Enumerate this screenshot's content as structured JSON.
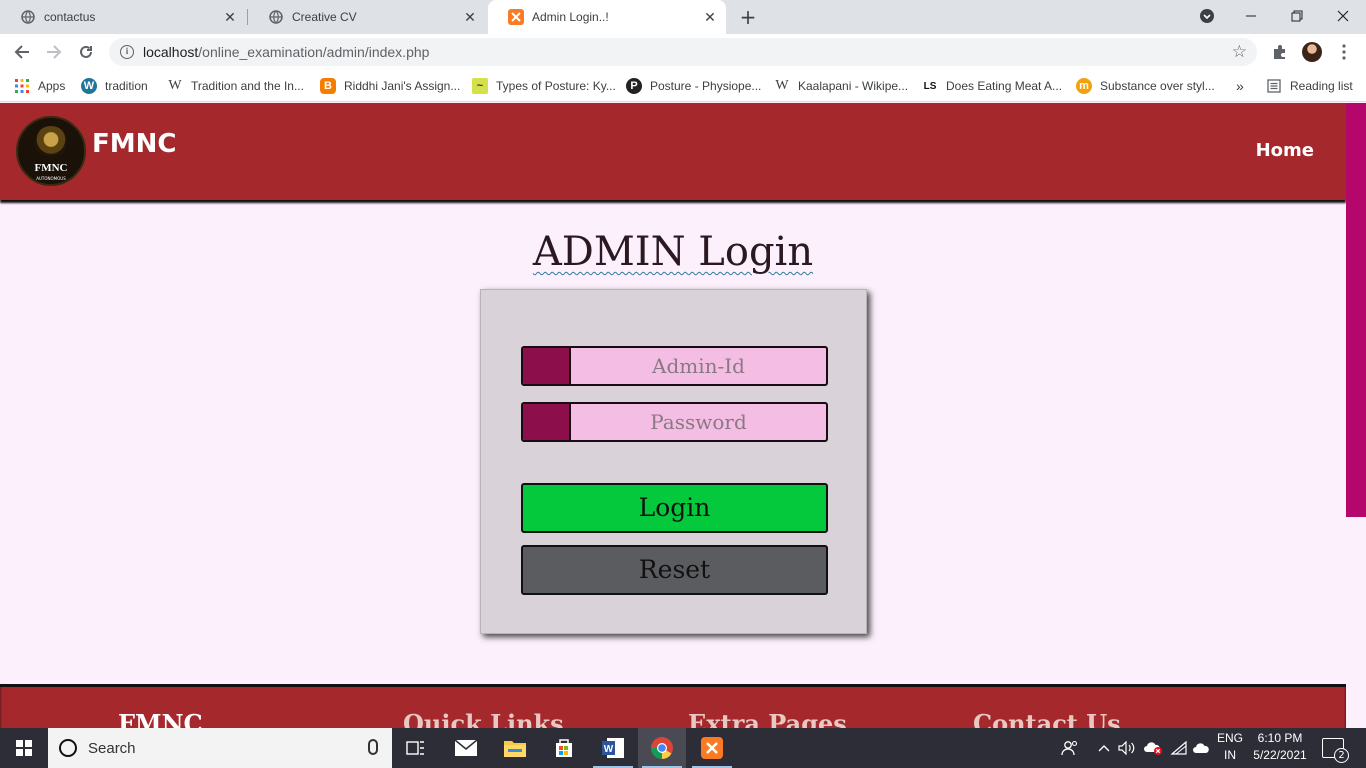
{
  "browser": {
    "tabs": [
      {
        "title": "contactus",
        "active": false
      },
      {
        "title": "Creative CV",
        "active": false
      },
      {
        "title": "Admin Login..!",
        "active": true
      }
    ],
    "url_host": "localhost",
    "url_path": "/online_examination/admin/index.php",
    "bookmarks": [
      {
        "label": "Apps",
        "icon": "apps-grid-icon"
      },
      {
        "label": "tradition",
        "icon": "wordpress-icon"
      },
      {
        "label": "Tradition and the In...",
        "icon": "wikipedia-icon"
      },
      {
        "label": "Riddhi Jani's Assign...",
        "icon": "blogger-icon"
      },
      {
        "label": "Types of Posture: Ky...",
        "icon": "site-icon"
      },
      {
        "label": "Posture - Physiope...",
        "icon": "physiopedia-icon"
      },
      {
        "label": "Kaalapani - Wikipe...",
        "icon": "wikipedia-icon"
      },
      {
        "label": "Does Eating Meat A...",
        "icon": "ls-icon"
      },
      {
        "label": "Substance over styl...",
        "icon": "site-icon"
      }
    ],
    "more_bookmarks": "»",
    "reading_list": "Reading list"
  },
  "site": {
    "brand": "FMNC",
    "logo_text": "FMNC",
    "logo_subtext": "AUTONOMOUS",
    "nav_home": "Home",
    "login_title": "ADMIN Login",
    "admin_id_placeholder": "Admin-Id",
    "password_placeholder": "Password",
    "login_button": "Login",
    "reset_button": "Reset",
    "footer": [
      "FMNC",
      "Quick Links",
      "Extra Pages",
      "Contact Us"
    ]
  },
  "taskbar": {
    "search_placeholder": "Search",
    "lang_line1": "ENG",
    "lang_line2": "IN",
    "time": "6:10 PM",
    "date": "5/22/2021",
    "notification_count": "2"
  },
  "colors": {
    "header": "#a5282c",
    "page_bg": "#fcf0fc",
    "field_icon": "#8c0f4c",
    "field_bg": "#f4bde3",
    "login_btn": "#04c93c",
    "reset_btn": "#5b5c5f",
    "scroll_thumb": "#b5076b"
  }
}
